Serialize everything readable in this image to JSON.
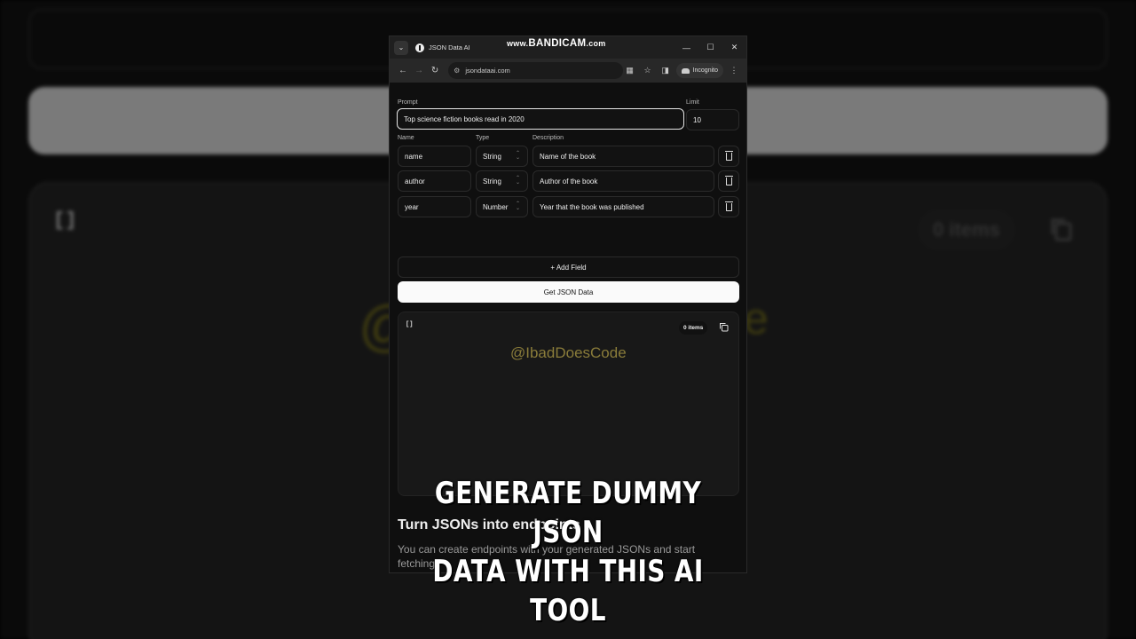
{
  "recorder": {
    "watermark_prefix": "www.",
    "watermark_brand": "BANDICAM",
    "watermark_suffix": ".com"
  },
  "browser": {
    "tab_title": "JSON Data AI",
    "url": "jsondataai.com",
    "incognito_label": "Incognito"
  },
  "form": {
    "prompt_label": "Prompt",
    "prompt_value": "Top science fiction books read in 2020",
    "limit_label": "Limit",
    "limit_value": "10",
    "name_header": "Name",
    "type_header": "Type",
    "description_header": "Description",
    "fields": [
      {
        "name": "name",
        "type": "String",
        "description": "Name of the book"
      },
      {
        "name": "author",
        "type": "String",
        "description": "Author of the book"
      },
      {
        "name": "year",
        "type": "Number",
        "description": "Year that the book was published"
      }
    ],
    "add_field_label": "+ Add Field",
    "submit_label": "Get JSON Data"
  },
  "output": {
    "json_text": "[]",
    "items_count": "0 items"
  },
  "video_watermark": "@IbadDoesCode",
  "endpoints": {
    "title": "Turn JSONs into endpoints",
    "description": "You can create endpoints with your generated JSONs and start fetching"
  },
  "caption": {
    "line1": "GENERATE DUMMY JSON",
    "line2": "DATA WITH THIS AI TOOL"
  },
  "background_mirror": {
    "bracket": "[]",
    "items": "0 items",
    "watermark_left": "@",
    "watermark_right": "e"
  }
}
